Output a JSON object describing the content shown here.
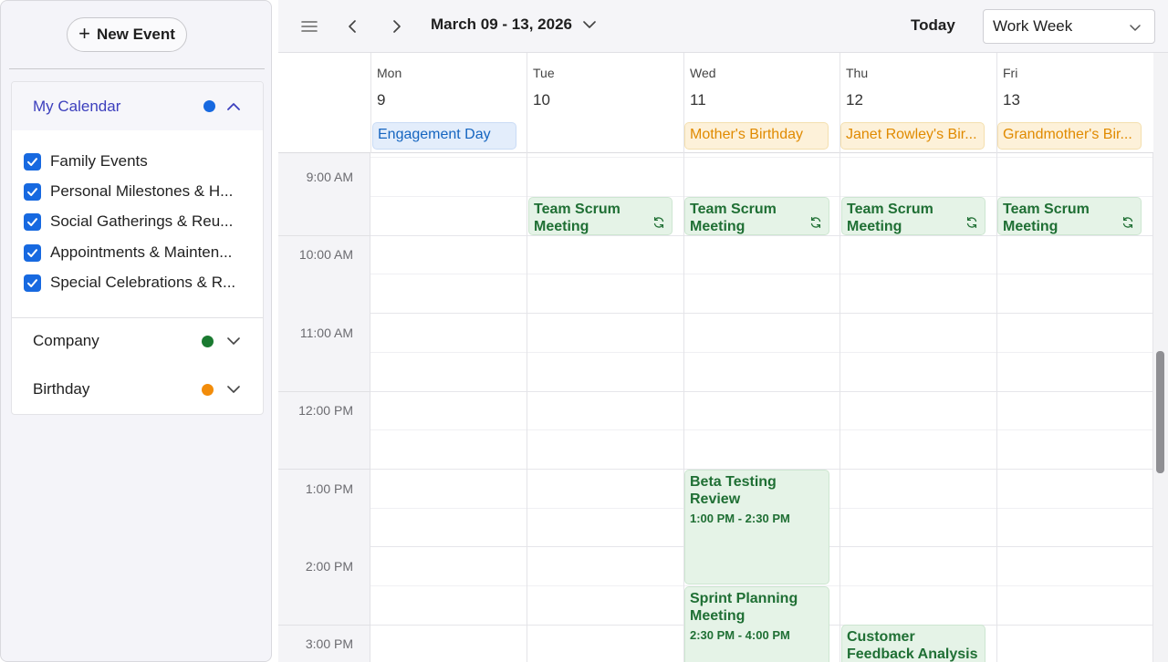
{
  "sidebar": {
    "new_event_label": "New Event",
    "my_calendar": {
      "title": "My Calendar",
      "color": "#1769e0",
      "items": [
        {
          "label": "Family Events"
        },
        {
          "label": "Personal Milestones & H..."
        },
        {
          "label": "Social Gatherings & Reu..."
        },
        {
          "label": "Appointments & Mainten..."
        },
        {
          "label": "Special Celebrations & R..."
        }
      ]
    },
    "company": {
      "title": "Company",
      "color": "#1a7a30"
    },
    "birthday": {
      "title": "Birthday",
      "color": "#f28c0a"
    }
  },
  "toolbar": {
    "menu_icon": "hamburger-icon",
    "prev_icon": "chevron-left-icon",
    "next_icon": "chevron-right-icon",
    "date_range": "March 09 - 13, 2026",
    "today_label": "Today",
    "view_selected": "Work Week"
  },
  "days": [
    {
      "name": "Mon",
      "num": "9",
      "allday": "Engagement Day",
      "allday_color": "blue"
    },
    {
      "name": "Tue",
      "num": "10",
      "allday": ""
    },
    {
      "name": "Wed",
      "num": "11",
      "allday": "Mother's Birthday",
      "allday_color": "orange"
    },
    {
      "name": "Thu",
      "num": "12",
      "allday": "Janet Rowley's Bir...",
      "allday_color": "orange"
    },
    {
      "name": "Fri",
      "num": "13",
      "allday": "Grandmother's Bir...",
      "allday_color": "orange"
    }
  ],
  "times": [
    "9:00 AM",
    "10:00 AM",
    "11:00 AM",
    "12:00 PM",
    "1:00 PM",
    "2:00 PM",
    "3:00 PM"
  ],
  "events": {
    "scrum_title": "Team Scrum Meeting",
    "beta": {
      "title": "Beta Testing Review",
      "time": "1:00 PM - 2:30 PM"
    },
    "sprint": {
      "title": "Sprint Planning Meeting",
      "time": "2:30 PM - 4:00 PM"
    },
    "customer": {
      "title": "Customer Feedback Analysis"
    }
  }
}
